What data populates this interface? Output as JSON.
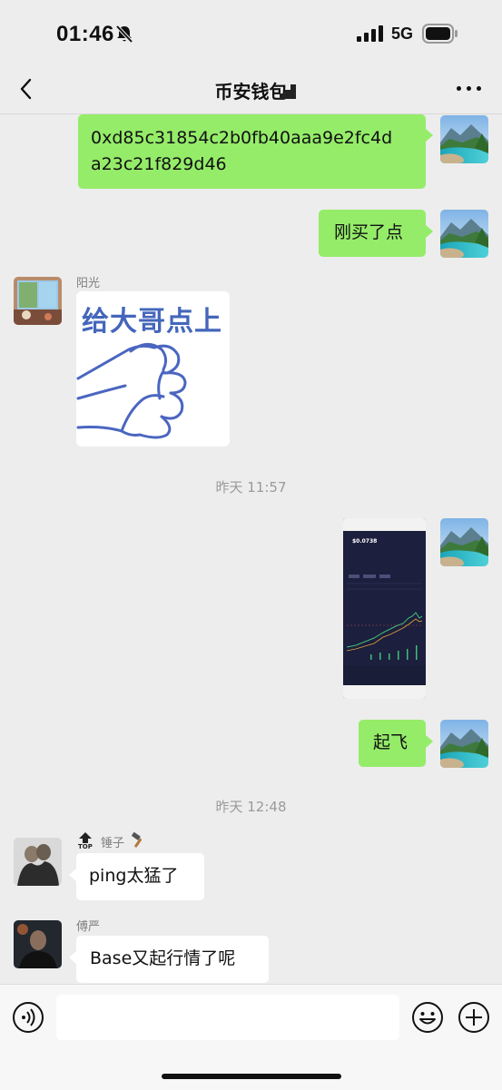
{
  "status_bar": {
    "time": "01:46",
    "network": "5G"
  },
  "header": {
    "title": "币安钱包"
  },
  "messages": {
    "address_text": "0xd85c31854c2b0fb40aaa9e2fc4da23c21f829d46",
    "address_line1": "0xd85c31854c2b0fb40aaa9e2fc4d",
    "address_line2": "a23c21f829d46",
    "bought": "刚买了点",
    "sender_yangguang": "阳光",
    "sticker_text": "给大哥点上",
    "timestamp1": "昨天 11:57",
    "shot_ticker": "$0.0738",
    "takeoff": "起飞",
    "timestamp2": "昨天 12:48",
    "sender_hammer": "锤子",
    "top_badge": "TOP",
    "ping_msg": "ping太猛了",
    "sender_fuyan": "傅严",
    "base_msg": "Base又起行情了呢"
  },
  "colors": {
    "my_bubble": "#95ec69",
    "their_bubble": "#ffffff",
    "background": "#ededed"
  },
  "icons": [
    "back-icon",
    "more-icon",
    "voice-icon",
    "emoji-icon",
    "add-icon"
  ]
}
